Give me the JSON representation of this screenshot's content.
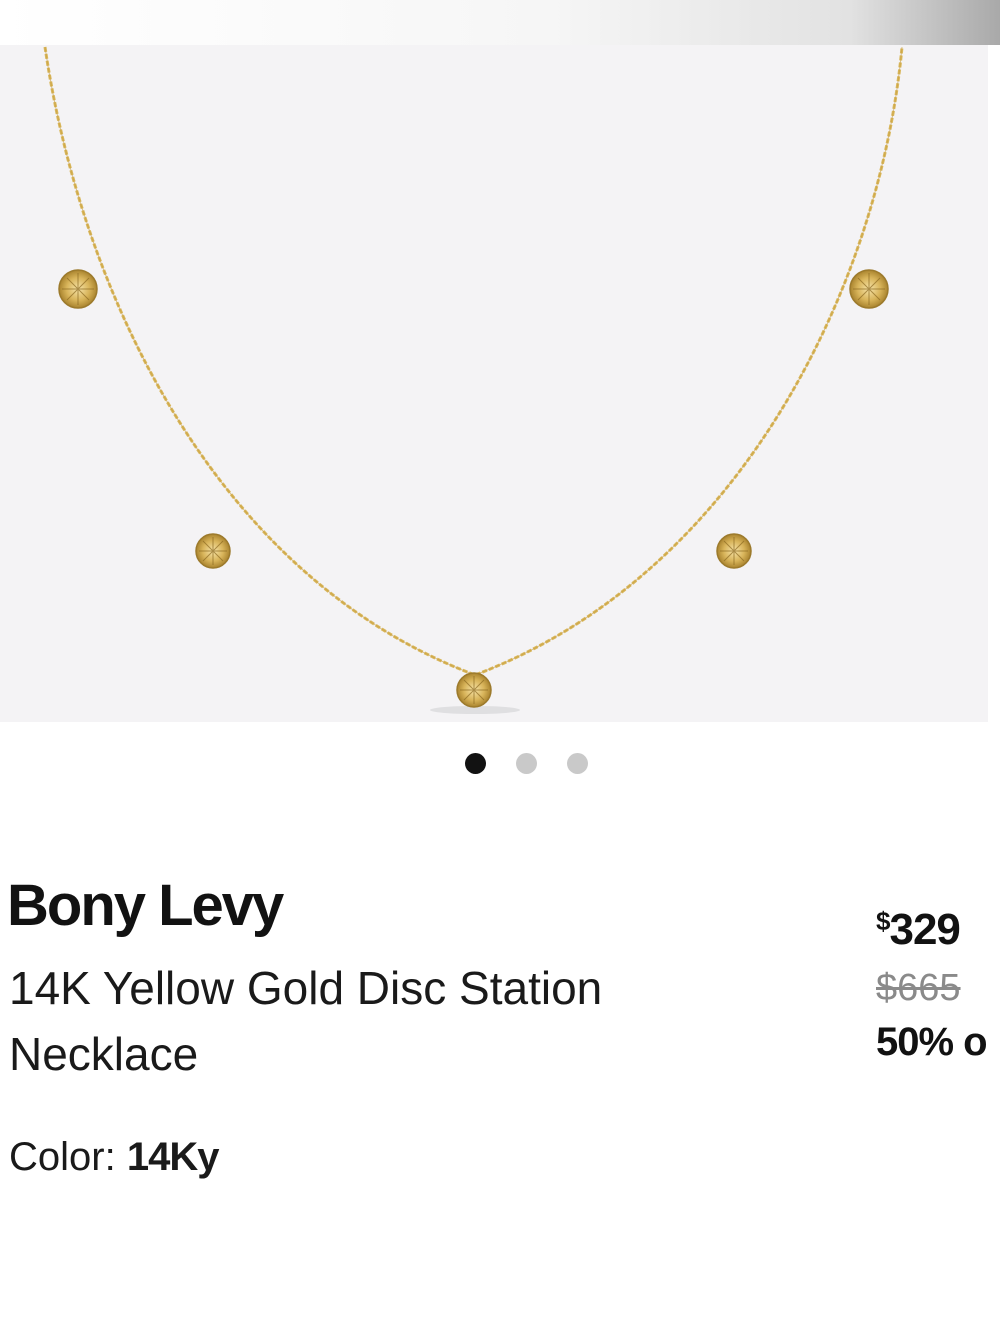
{
  "colors": {
    "image_background": "#f4f3f5",
    "gold": "#d8b45a",
    "text_primary": "#121212",
    "text_muted": "#8a8a8a",
    "dot_active": "#121212",
    "dot_inactive": "#c9c9c9"
  },
  "gallery": {
    "image_subject": "gold-disc-station-necklace",
    "total_images": 3,
    "active_index": 0
  },
  "product": {
    "brand": "Bony Levy",
    "name": "14K Yellow Gold Disc Station Necklace",
    "color_label": "Color:",
    "color_value": "14Ky"
  },
  "pricing": {
    "sale_currency": "$",
    "sale_amount": "329",
    "original_price": "$665",
    "discount": "50% o"
  }
}
